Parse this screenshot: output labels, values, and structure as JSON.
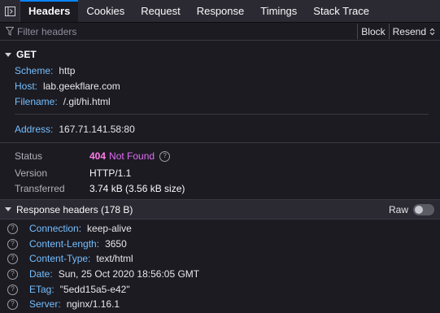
{
  "tabs": [
    "Headers",
    "Cookies",
    "Request",
    "Response",
    "Timings",
    "Stack Trace"
  ],
  "filter": {
    "placeholder": "Filter headers",
    "block_label": "Block",
    "resend_label": "Resend"
  },
  "request": {
    "method": "GET",
    "scheme_key": "Scheme:",
    "scheme_val": "http",
    "host_key": "Host:",
    "host_val": "lab.geekflare.com",
    "filename_key": "Filename:",
    "filename_val": "/.git/hi.html",
    "address_key": "Address:",
    "address_val": "167.71.141.58:80"
  },
  "summary": {
    "status_label": "Status",
    "status_code": "404",
    "status_text": "Not Found",
    "version_label": "Version",
    "version_val": "HTTP/1.1",
    "transferred_label": "Transferred",
    "transferred_val": "3.74 kB (3.56 kB size)"
  },
  "response_headers": {
    "title": "Response headers (178 B)",
    "raw_label": "Raw",
    "items": [
      {
        "name": "Connection:",
        "value": "keep-alive"
      },
      {
        "name": "Content-Length:",
        "value": "3650"
      },
      {
        "name": "Content-Type:",
        "value": "text/html"
      },
      {
        "name": "Date:",
        "value": "Sun, 25 Oct 2020 18:56:05 GMT"
      },
      {
        "name": "ETag:",
        "value": "\"5edd15a5-e42\""
      },
      {
        "name": "Server:",
        "value": "nginx/1.16.1"
      }
    ]
  },
  "colors": {
    "accent": "#0a84ff",
    "key": "#75bfff",
    "status_code": "#ff7de9",
    "status_text": "#e06cf6"
  }
}
